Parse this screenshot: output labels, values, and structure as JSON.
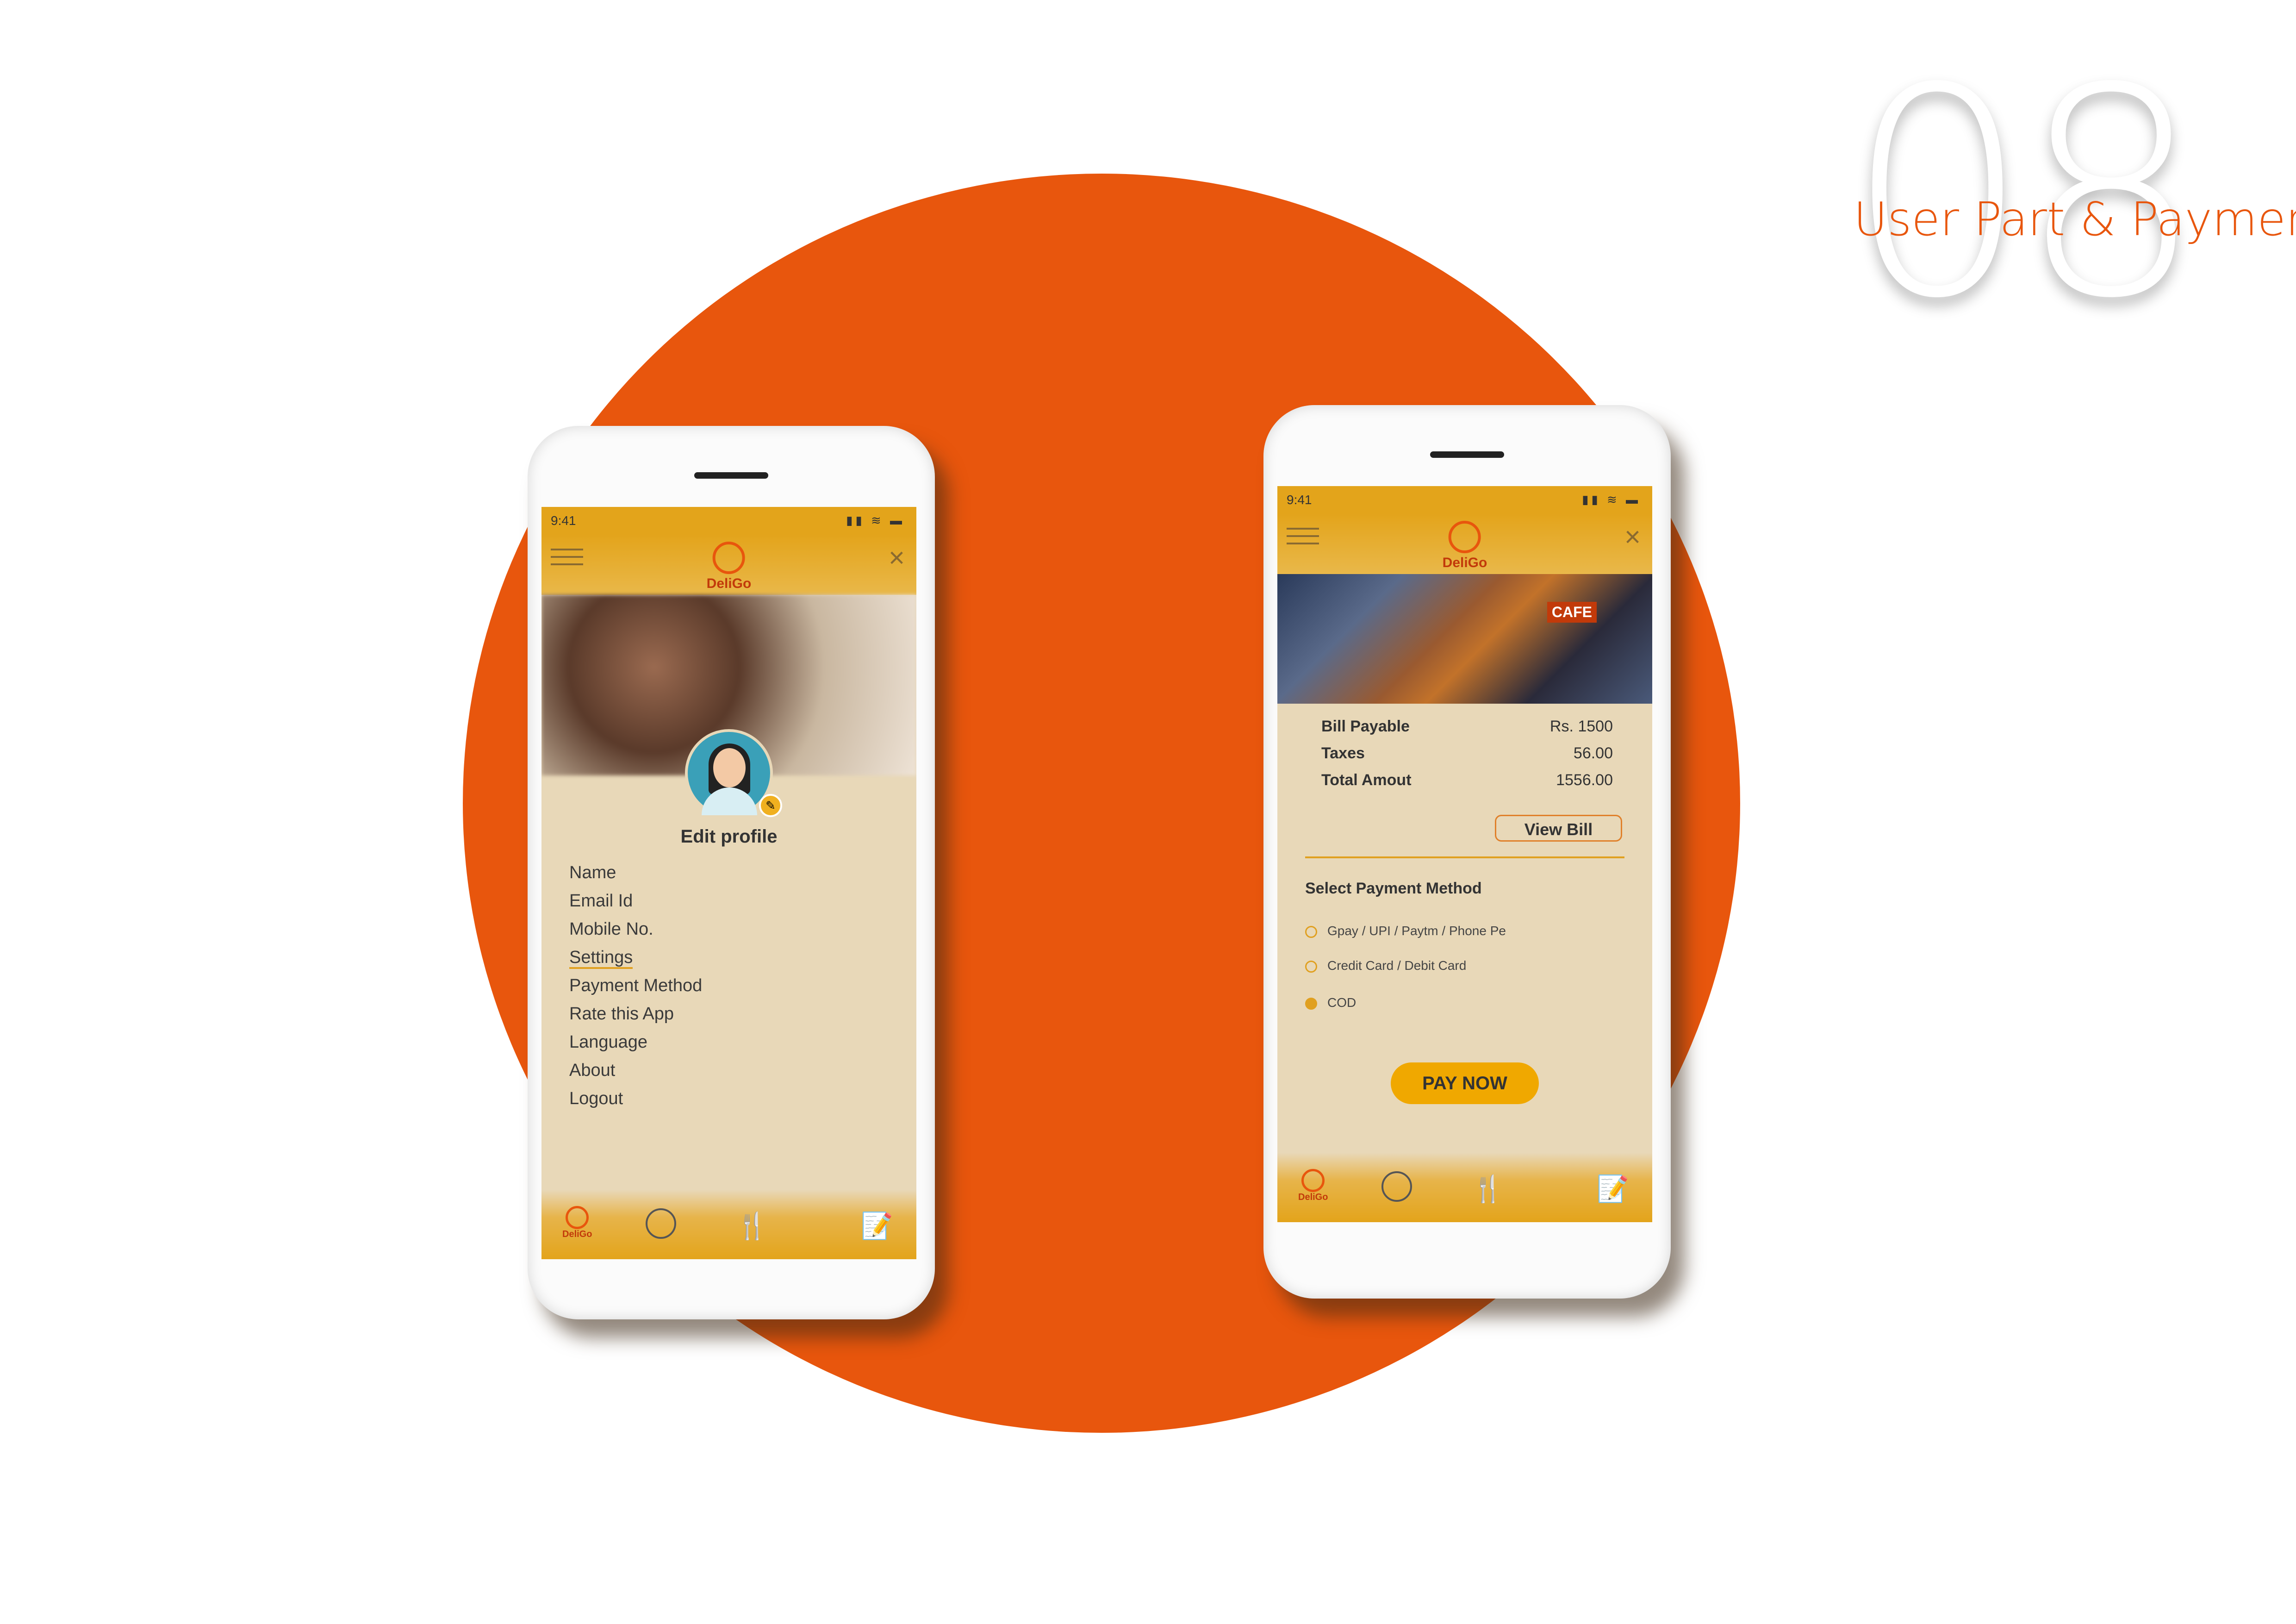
{
  "header": {
    "number": "08",
    "subtitle": "User Part & Payment"
  },
  "colors": {
    "accent": "#e8560d",
    "gold": "#e3a41b",
    "panel": "#e8d8b8"
  },
  "status_bar": {
    "time": "9:41"
  },
  "app": {
    "brand": "DeliGo"
  },
  "profile_screen": {
    "title": "Edit profile",
    "menu": [
      "Name",
      "Email Id",
      "Mobile No.",
      "Settings",
      "Payment Method",
      "Rate this App",
      "Language",
      "About",
      "Logout"
    ]
  },
  "payment_screen": {
    "cafe_sign": "CAFE",
    "bill_rows": [
      {
        "label": "Bill Payable",
        "value": "Rs. 1500"
      },
      {
        "label": "Taxes",
        "value": "56.00"
      },
      {
        "label": "Total Amout",
        "value": "1556.00"
      }
    ],
    "view_bill": "View Bill",
    "method_title": "Select Payment Method",
    "options": [
      {
        "label": "Gpay / UPI / Paytm / Phone Pe",
        "selected": false
      },
      {
        "label": "Credit Card / Debit Card",
        "selected": false
      },
      {
        "label": "COD",
        "selected": true
      }
    ],
    "pay_button": "PAY NOW"
  },
  "bottom_nav": [
    "brand-icon",
    "user-icon",
    "fork-knife-icon",
    "notepad-icon"
  ]
}
